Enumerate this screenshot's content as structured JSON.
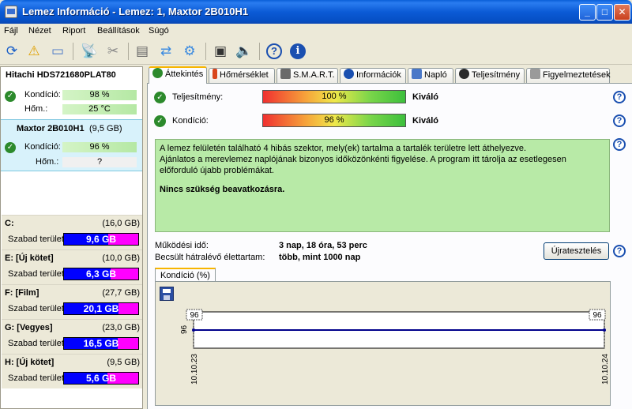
{
  "window": {
    "title": "Lemez Információ - Lemez: 1, Maxtor 2B010H1"
  },
  "menu": [
    "Fájl",
    "Nézet",
    "Riport",
    "Beállítások",
    "Súgó"
  ],
  "disks": [
    {
      "name": "Hitachi HDS721680PLAT80",
      "size": "",
      "kondicio_label": "Kondíció:",
      "kondicio": "98 %",
      "hom_label": "Hőm.:",
      "hom": "25 °C",
      "selected": false
    },
    {
      "name": "Maxtor 2B010H1",
      "size": "(9,5 GB)",
      "kondicio_label": "Kondíció:",
      "kondicio": "96 %",
      "hom_label": "Hőm.:",
      "hom": "?",
      "selected": true
    }
  ],
  "drives": [
    {
      "name": "C:",
      "size": "(16,0 GB)",
      "free_label": "Szabad terület",
      "free": "9,6 GB",
      "free_fraction": 0.6
    },
    {
      "name": "E: [Új kötet]",
      "size": "(10,0 GB)",
      "free_label": "Szabad terület",
      "free": "6,3 GB",
      "free_fraction": 0.63
    },
    {
      "name": "F: [Film]",
      "size": "(27,7 GB)",
      "free_label": "Szabad terület",
      "free": "20,1 GB",
      "free_fraction": 0.73
    },
    {
      "name": "G: [Vegyes]",
      "size": "(23,0 GB)",
      "free_label": "Szabad terület",
      "free": "16,5 GB",
      "free_fraction": 0.72
    },
    {
      "name": "H: [Új kötet]",
      "size": "(9,5 GB)",
      "free_label": "Szabad terület",
      "free": "5,6 GB",
      "free_fraction": 0.59
    }
  ],
  "tabs": [
    {
      "label": "Áttekintés",
      "icon": "check-icon",
      "color": "#2c8a2c"
    },
    {
      "label": "Hőmérséklet",
      "icon": "thermometer-icon",
      "color": "#d9461c"
    },
    {
      "label": "S.M.A.R.T.",
      "icon": "disk-icon",
      "color": "#6a6a6a"
    },
    {
      "label": "Információk",
      "icon": "info-icon",
      "color": "#1a4fb0"
    },
    {
      "label": "Napló",
      "icon": "log-icon",
      "color": "#4a78c8"
    },
    {
      "label": "Teljesítmény",
      "icon": "gauge-icon",
      "color": "#2a2a2a"
    },
    {
      "label": "Figyelmeztetések",
      "icon": "warning-doc-icon",
      "color": "#9a9a9a"
    }
  ],
  "overview": {
    "performance_label": "Teljesítmény:",
    "performance_value": "100 %",
    "performance_rating": "Kiváló",
    "condition_label": "Kondíció:",
    "condition_value": "96 %",
    "condition_rating": "Kiváló",
    "message_lines": [
      "A lemez felületén található 4 hibás szektor, mely(ek) tartalma a tartalék területre lett áthelyezve.",
      "Ajánlatos a merevlemez naplójának bizonyos időközönkénti figyelése. A program itt tárolja az esetlegesen előforduló újabb problémákat."
    ],
    "message_bold": "Nincs szükség beavatkozásra.",
    "uptime_label": "Működési idő:",
    "uptime_value": "3 nap, 18 óra, 53 perc",
    "remaining_label": "Becsült hátralévő élettartam:",
    "remaining_value": "több, mint 1000 nap",
    "retest_button": "Újratesztelés",
    "chart_tab": "Kondíció  (%)"
  },
  "chart_data": {
    "type": "line",
    "title": "Kondíció  (%)",
    "x": [
      "10.10.23",
      "10.10.24"
    ],
    "series": [
      {
        "name": "",
        "values": [
          96,
          96
        ]
      }
    ],
    "ylabel": "96",
    "point_labels": [
      "96",
      "96"
    ],
    "color": "#00008b"
  }
}
